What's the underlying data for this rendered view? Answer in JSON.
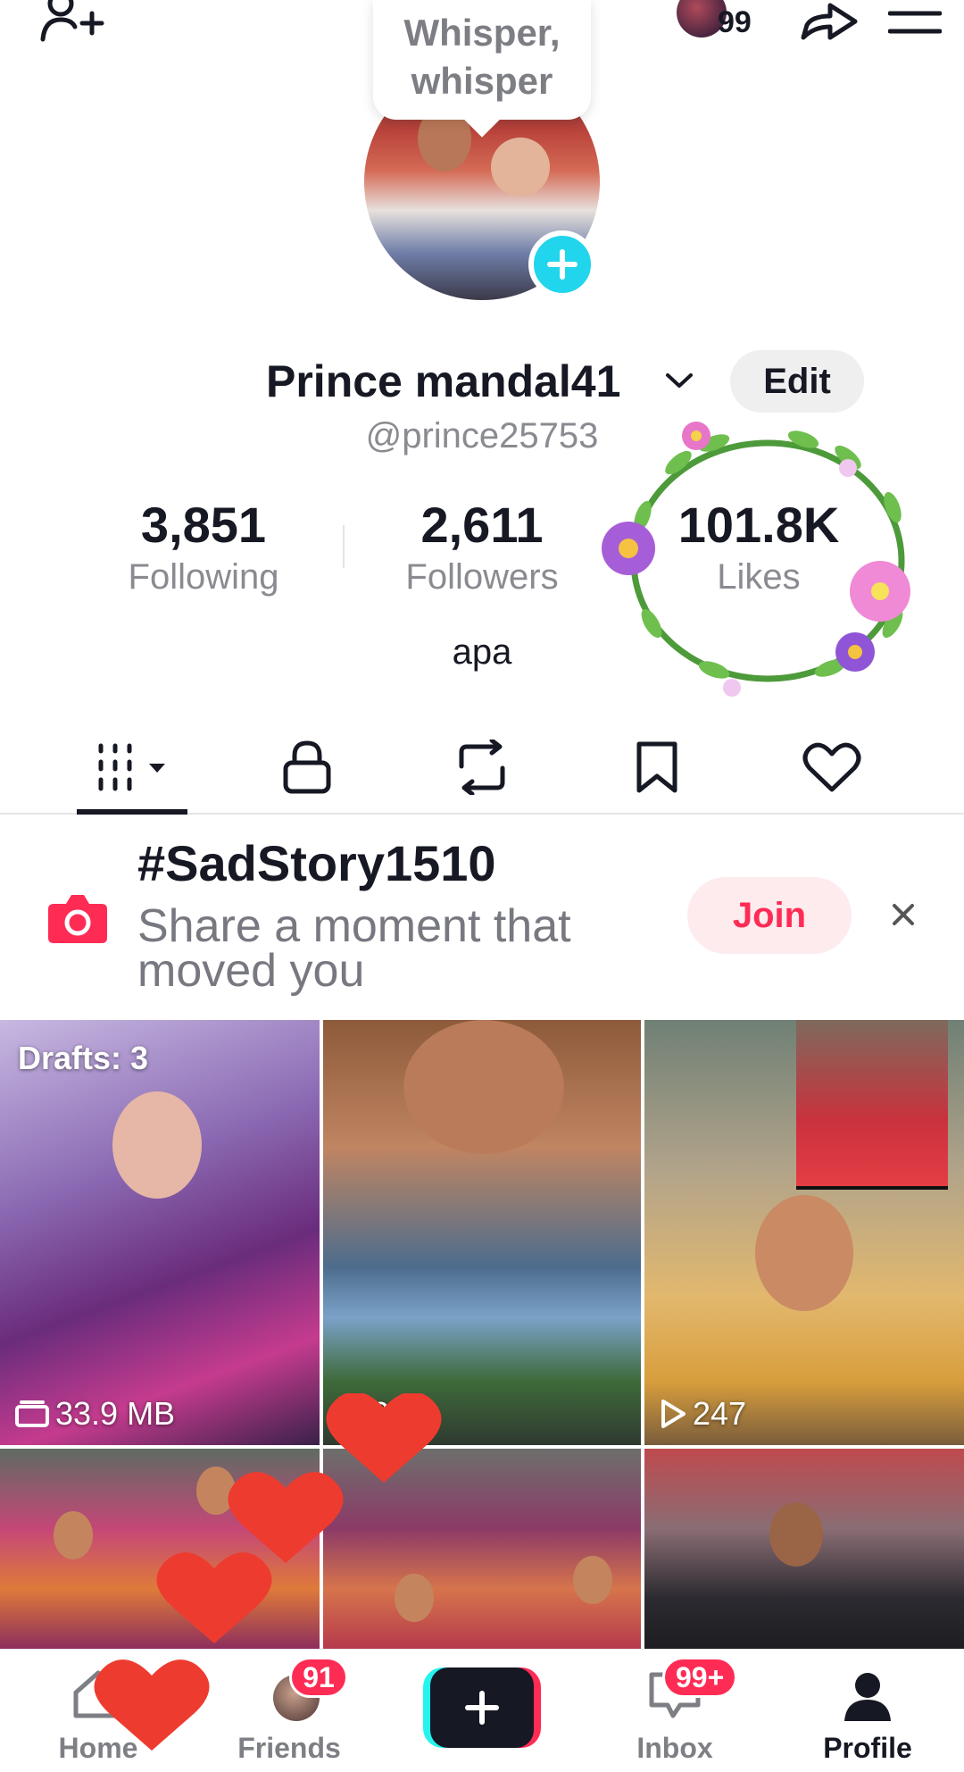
{
  "topbar": {
    "story_count": "99"
  },
  "whisper": {
    "line1": "Whisper,",
    "line2": "whisper"
  },
  "profile": {
    "display_name": "Prince mandal41",
    "edit_label": "Edit",
    "handle": "@prince25753",
    "bio": "apa"
  },
  "stats": [
    {
      "value": "3,851",
      "label": "Following"
    },
    {
      "value": "2,611",
      "label": "Followers"
    },
    {
      "value": "101.8K",
      "label": "Likes"
    }
  ],
  "tabs": [
    {
      "icon": "grid-icon",
      "active": true
    },
    {
      "icon": "lock-icon",
      "active": false
    },
    {
      "icon": "repost-icon",
      "active": false
    },
    {
      "icon": "bookmark-icon",
      "active": false
    },
    {
      "icon": "heart-icon",
      "active": false
    }
  ],
  "challenge": {
    "title": "#SadStory1510",
    "subtitle": "Share a moment that moved you",
    "join_label": "Join"
  },
  "videos": [
    {
      "top_label": "Drafts: 3",
      "bottom_label": "33.9 MB",
      "bottom_icon": "drafts-folder-icon"
    },
    {
      "bottom_label": "213",
      "bottom_icon": "play-icon"
    },
    {
      "bottom_label": "247",
      "bottom_icon": "play-icon"
    },
    {},
    {},
    {}
  ],
  "bottom_nav": {
    "home": "Home",
    "friends": "Friends",
    "friends_badge": "91",
    "inbox": "Inbox",
    "inbox_badge": "99+",
    "profile": "Profile"
  },
  "colors": {
    "accent": "#fe2c55",
    "cyan": "#25f4ee",
    "avatar_plus": "#20d5ec",
    "text_primary": "#161823",
    "text_secondary": "#8a8b91"
  }
}
